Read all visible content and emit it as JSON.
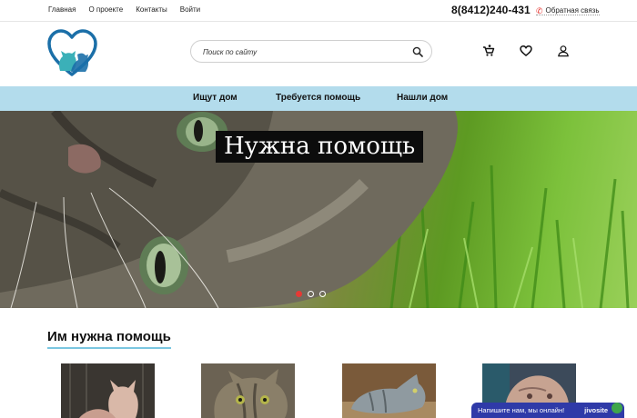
{
  "topbar": {
    "nav": [
      "Главная",
      "О проекте",
      "Контакты",
      "Войти"
    ],
    "phone": "8(8412)240-431",
    "feedback": "Обратная связь"
  },
  "header": {
    "search_placeholder": "Поиск по сайту",
    "icons": [
      "cart-icon",
      "heart-icon",
      "user-icon",
      "search-icon"
    ]
  },
  "mainnav": [
    "Ищут дом",
    "Требуется помощь",
    "Нашли дом"
  ],
  "hero": {
    "title": "Нужна помощь",
    "slides": 3,
    "active_slide": 1
  },
  "section": {
    "title": "Им нужна помощь"
  },
  "chat": {
    "text": "Напишите нам, мы онлайн!",
    "brand": "jivosite"
  },
  "colors": {
    "nav_bg": "#b3dcec",
    "accent_red": "#e53935",
    "logo_blue": "#1b6fa8",
    "logo_teal": "#3bb0b8",
    "chat_bg": "#2f3aa8"
  }
}
